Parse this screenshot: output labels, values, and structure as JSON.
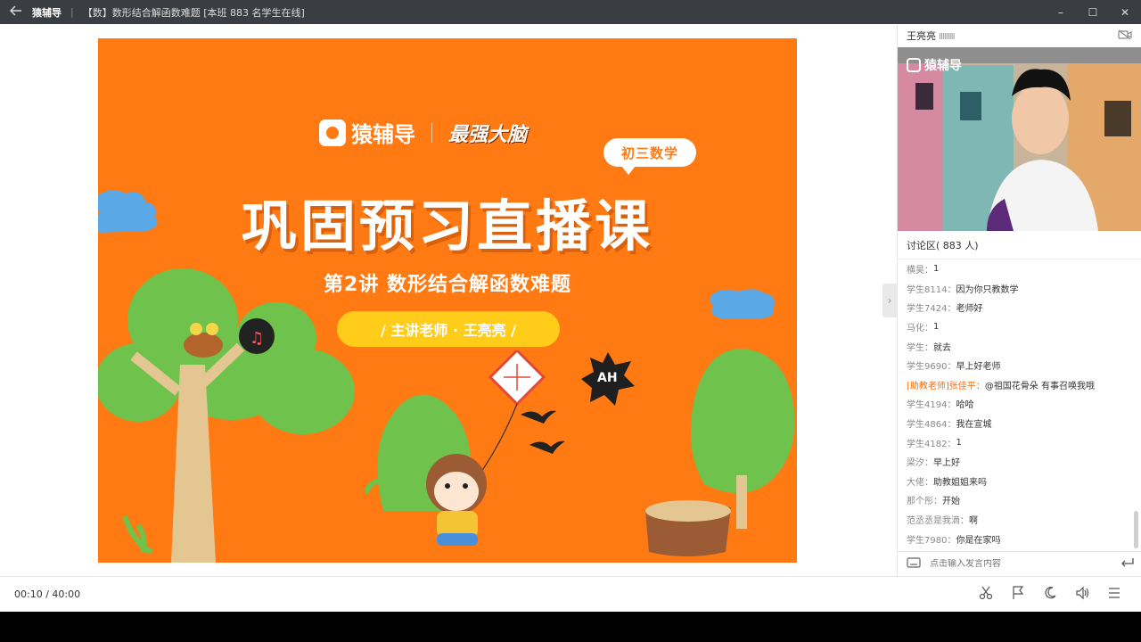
{
  "titlebar": {
    "back_icon": "back-arrow-icon",
    "app_name": "猿辅导",
    "separator": "|",
    "window_title": "【数】数形结合解函数难题 [本班 883 名学生在线]",
    "minimize": "–",
    "maximize": "☐",
    "close": "✕"
  },
  "slide": {
    "brand_name": "猿辅导",
    "brand_secondary": "最强大脑",
    "grade_tag": "初三数学",
    "title": "巩固预习直播课",
    "subtitle": "第2讲  数形结合解函数难题",
    "teacher": "/  主讲老师 · 王亮亮  /",
    "sticker_text": "AH",
    "colors": {
      "background": "#ff7a12",
      "pill": "#ffcc1a"
    }
  },
  "sidebar": {
    "teacher_name": "王亮亮",
    "signal": "IIIIIIIII",
    "camera_watermark": "猿辅导",
    "discussion_label": "讨论区( 883 人)",
    "messages": [
      {
        "who": "横昊",
        "text": "1",
        "assist": false
      },
      {
        "who": "学生8114",
        "text": "因为你只教数学",
        "assist": false
      },
      {
        "who": "学生7424",
        "text": "老师好",
        "assist": false
      },
      {
        "who": "马化",
        "text": "1",
        "assist": false
      },
      {
        "who": "学生",
        "text": "就去",
        "assist": false
      },
      {
        "who": "学生9690",
        "text": "早上好老师",
        "assist": false
      },
      {
        "who": "[助教老师]张佳平",
        "text": "@祖国花骨朵 有事召唤我哦",
        "assist": true
      },
      {
        "who": "学生4194",
        "text": "哈哈",
        "assist": false
      },
      {
        "who": "学生4864",
        "text": "我在宣城",
        "assist": false
      },
      {
        "who": "学生4182",
        "text": "1",
        "assist": false
      },
      {
        "who": "梁汐",
        "text": "早上好",
        "assist": false
      },
      {
        "who": "大佬",
        "text": "助教姐姐来吗",
        "assist": false
      },
      {
        "who": "那个彤",
        "text": "开始",
        "assist": false
      },
      {
        "who": "范丞丞是我滴",
        "text": "啊",
        "assist": false
      },
      {
        "who": "学生7980",
        "text": "你是在家吗",
        "assist": false
      }
    ],
    "input_placeholder": "点击输入发言内容",
    "collapse": "›"
  },
  "bottombar": {
    "time": "00:10 / 40:00",
    "tools": [
      "scissors-icon",
      "flag-icon",
      "moon-icon",
      "speaker-icon",
      "menu-icon"
    ]
  }
}
